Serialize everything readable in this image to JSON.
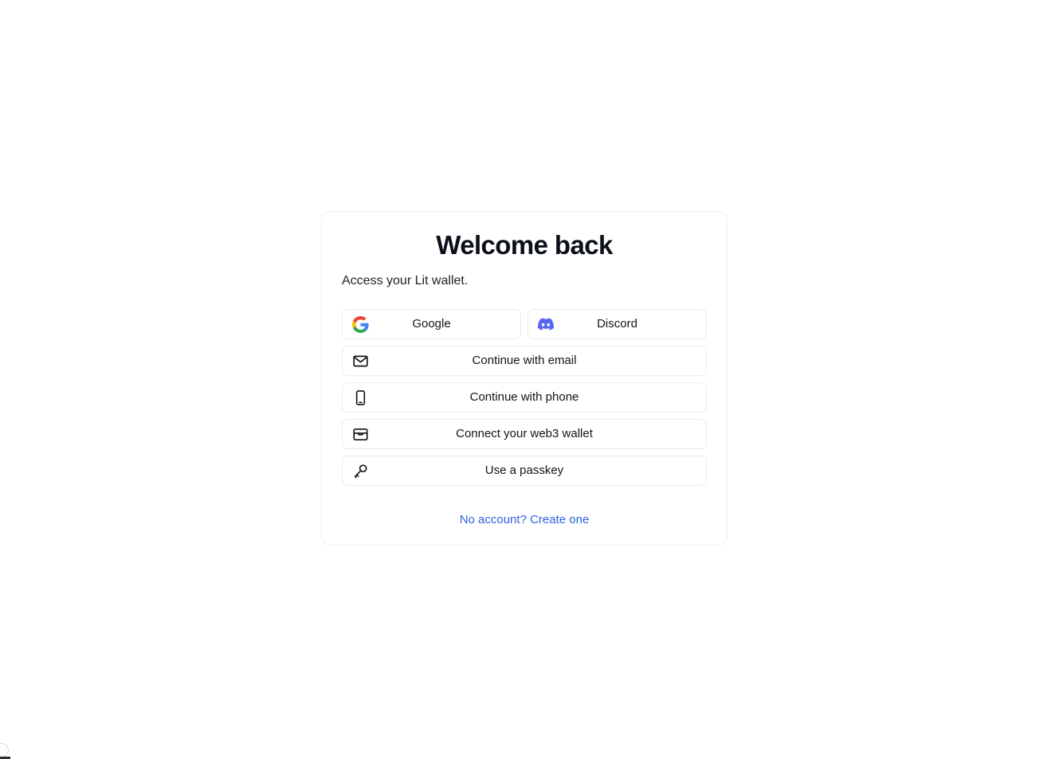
{
  "page": {
    "background_color": "#ffffff"
  },
  "card": {
    "title": "Welcome back",
    "subtitle": "Access your Lit wallet.",
    "border_color": "#eceef1",
    "background_color": "#ffffff"
  },
  "providers": {
    "social_row": [
      {
        "label": "Google",
        "icon": "google-icon"
      },
      {
        "label": "Discord",
        "icon": "discord-icon"
      }
    ],
    "methods": [
      {
        "label": "Continue with email",
        "icon": "envelope-icon"
      },
      {
        "label": "Continue with phone",
        "icon": "smartphone-icon"
      },
      {
        "label": "Connect your web3 wallet",
        "icon": "wallet-icon"
      },
      {
        "label": "Use a passkey",
        "icon": "key-icon"
      }
    ]
  },
  "footer": {
    "link_text": "No account? Create one",
    "link_color": "#2f62e0"
  },
  "colors": {
    "google_blue": "#4285F4",
    "google_red": "#EA4335",
    "google_yellow": "#FBBC05",
    "google_green": "#34A853",
    "discord_blurple": "#5865F2",
    "text_primary": "#111418",
    "link": "#2f62e0"
  }
}
